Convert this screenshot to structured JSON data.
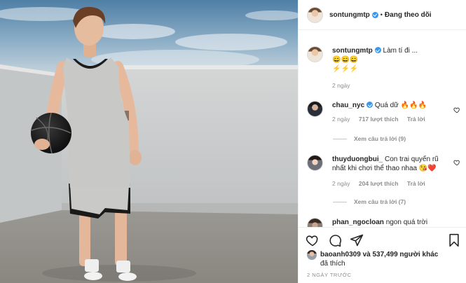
{
  "header": {
    "username": "sontungmtp",
    "separator": "•",
    "follow_status": "Đang theo dõi"
  },
  "caption": {
    "username": "sontungmtp",
    "text": "Làm tí đi ...",
    "emoji_line_1": "😄😄😄",
    "emoji_line_2": "⚡⚡⚡",
    "time": "2 ngày"
  },
  "comments": [
    {
      "username": "chau_nyc",
      "verified": true,
      "text": "Quá dữ 🔥🔥🔥",
      "time": "2 ngày",
      "likes": "717 lượt thích",
      "reply": "Trả lời",
      "view_replies": "Xem câu trả lời (9)"
    },
    {
      "username": "thuyduongbui_",
      "verified": false,
      "text": "Con trai quyến rũ nhất khi chơi thể thao nhaa 😘❤️",
      "time": "2 ngày",
      "likes": "204 lượt thích",
      "reply": "Trả lời",
      "view_replies": "Xem câu trả lời (7)"
    },
    {
      "username": "phan_ngocloan",
      "text": "ngon quá trời"
    }
  ],
  "likes": {
    "first_user": "baoanh0309",
    "rest": "và 537,499 người khác",
    "suffix": "đã thích"
  },
  "posted_ago": "2 NGÀY TRƯỚC",
  "icons": {
    "like": "heart-icon",
    "comment": "comment-icon",
    "share": "share-icon",
    "save": "bookmark-icon"
  },
  "colors": {
    "verified": "#3897f0",
    "text": "#262626",
    "muted": "#8e8e8e"
  }
}
